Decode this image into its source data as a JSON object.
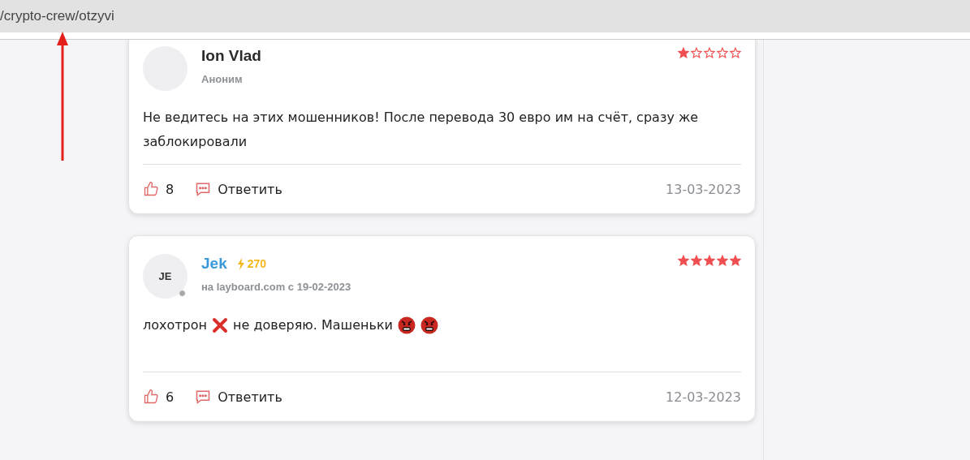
{
  "address_bar": {
    "url": "/crypto-crew/otzyvi"
  },
  "reviews": [
    {
      "kind": "anonymous",
      "author": "Ion Vlad",
      "subtitle": "Аноним",
      "stars": 1,
      "body": [
        {
          "kind": "text",
          "text": "Не ведитесь на этих мошенников! После перевода 30 евро им на счёт, сразу же заблокировали"
        }
      ],
      "likes": "8",
      "reply": "Ответить",
      "date": "13-03-2023"
    },
    {
      "kind": "member",
      "author": "Jek",
      "initials": "JE",
      "online": false,
      "karma": "270",
      "subtitle": "на layboard.com с 19-02-2023",
      "stars": 5,
      "body": [
        {
          "kind": "text",
          "text": "лохотрон"
        },
        {
          "kind": "cross"
        },
        {
          "kind": "text",
          "text": "не доверяю. Машеньки"
        },
        {
          "kind": "angry"
        },
        {
          "kind": "angry"
        }
      ],
      "likes": "6",
      "reply": "Ответить",
      "date": "12-03-2023"
    }
  ]
}
